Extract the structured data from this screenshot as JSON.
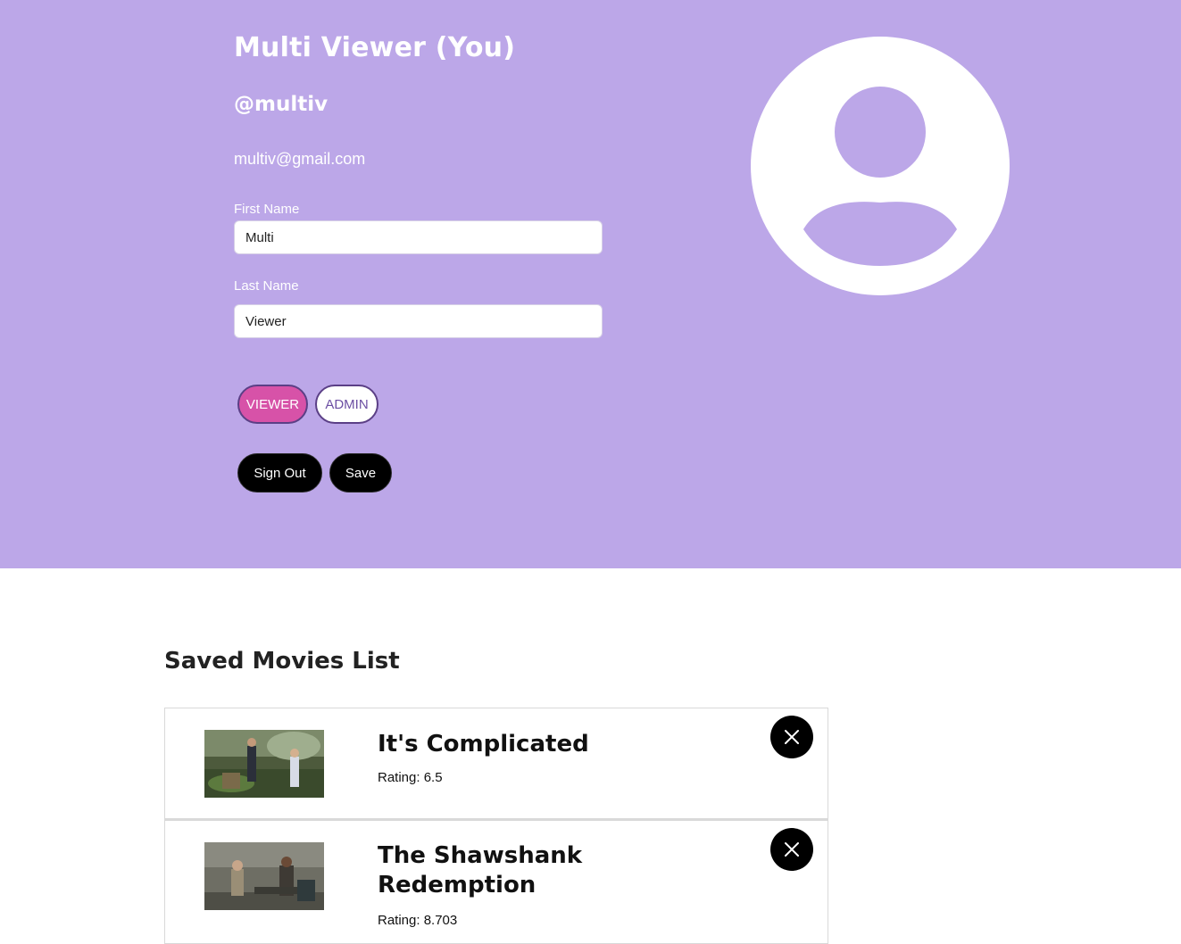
{
  "profile": {
    "display_name": "Multi Viewer (You)",
    "handle": "@multiv",
    "email": "multiv@gmail.com",
    "first_name_label": "First Name",
    "first_name_value": "Multi",
    "last_name_label": "Last Name",
    "last_name_value": "Viewer",
    "roles": {
      "viewer": "VIEWER",
      "admin": "ADMIN",
      "selected": "VIEWER"
    },
    "sign_out_label": "Sign Out",
    "save_label": "Save",
    "avatar_icon": "user-silhouette-icon"
  },
  "saved_movies": {
    "title": "Saved Movies List",
    "items": [
      {
        "title": "It's Complicated",
        "rating_text": "Rating: 6.5"
      },
      {
        "title": "The Shawshank Redemption",
        "rating_text": "Rating: 8.703"
      }
    ],
    "remove_icon": "close-icon"
  },
  "colors": {
    "profile_background": "#bca7e8",
    "viewer_active": "#d752a8",
    "role_border": "#5b3f86",
    "button_dark": "#000000"
  }
}
